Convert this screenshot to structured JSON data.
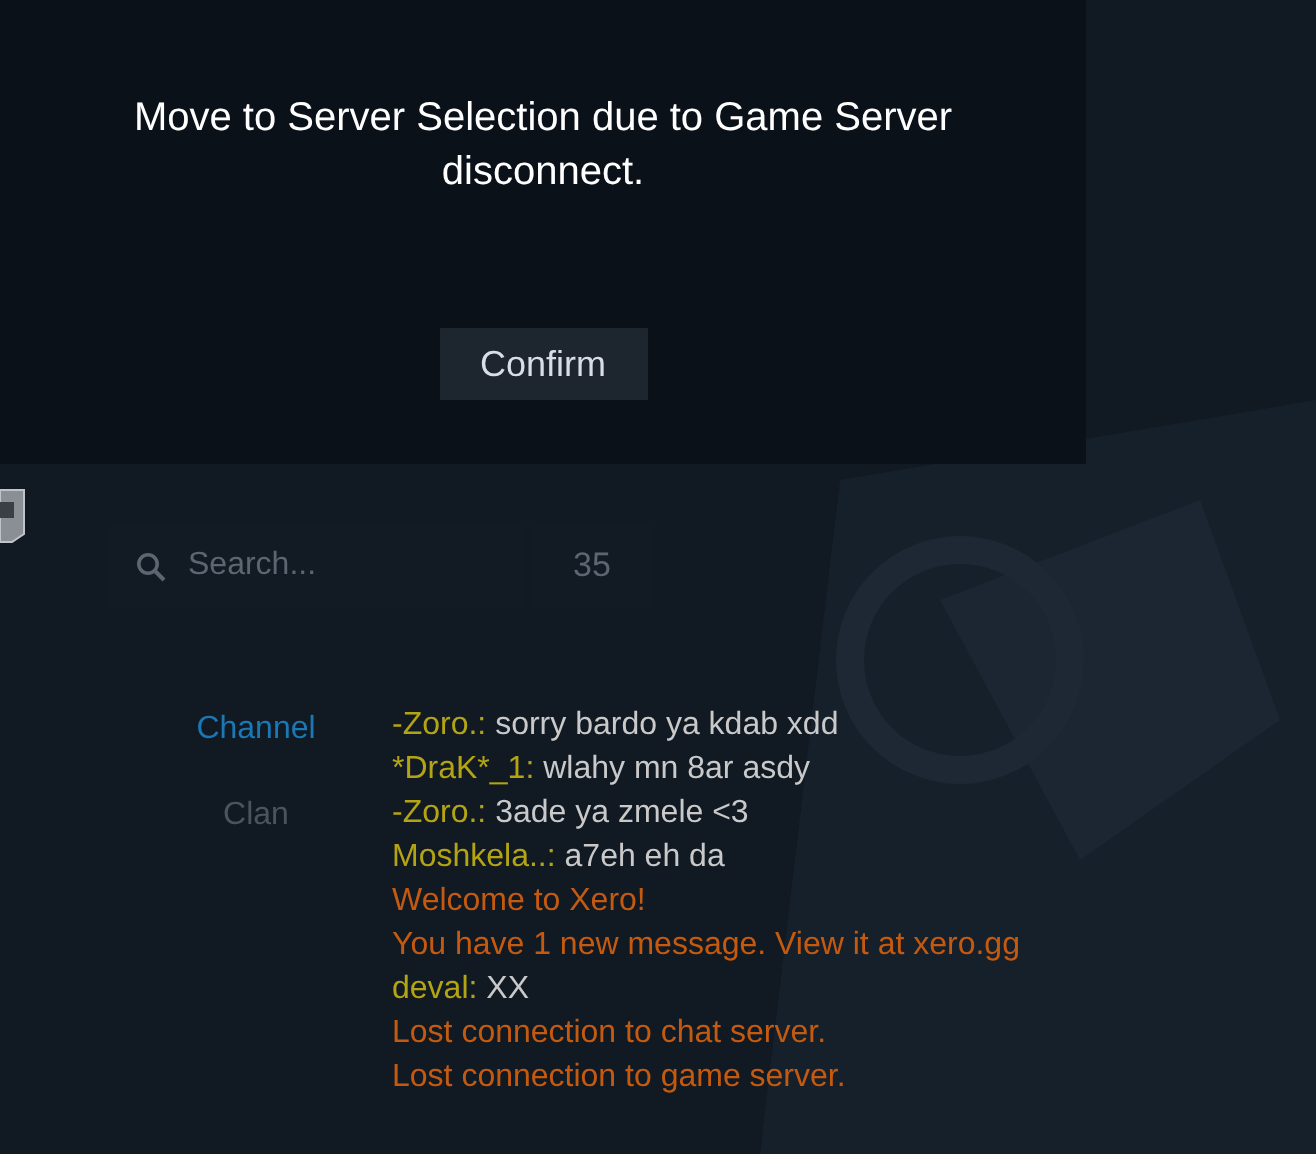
{
  "dialog": {
    "message": "Move to Server Selection due to Game Server disconnect.",
    "button": "Confirm"
  },
  "search": {
    "placeholder": "Search...",
    "count": "35"
  },
  "chat_tabs": [
    {
      "label": "Channel",
      "selected": true
    },
    {
      "label": "Clan",
      "selected": false
    }
  ],
  "messages": [
    {
      "kind": "chat",
      "author": "-Zoro.:",
      "text": "sorry bardo ya kdab xdd"
    },
    {
      "kind": "chat",
      "author": "*DraK*_1:",
      "text": "wlahy mn 8ar asdy"
    },
    {
      "kind": "chat",
      "author": "-Zoro.:",
      "text": "3ade ya zmele <3"
    },
    {
      "kind": "chat",
      "author": "Moshkela..:",
      "text": "a7eh eh da"
    },
    {
      "kind": "system",
      "text": "Welcome to Xero!"
    },
    {
      "kind": "system",
      "text": "You have 1 new message. View it at xero.gg"
    },
    {
      "kind": "chat",
      "author": "deval:",
      "text": "XX"
    },
    {
      "kind": "system",
      "text": "Lost connection to chat server."
    },
    {
      "kind": "system",
      "text": "Lost connection to game server."
    }
  ]
}
